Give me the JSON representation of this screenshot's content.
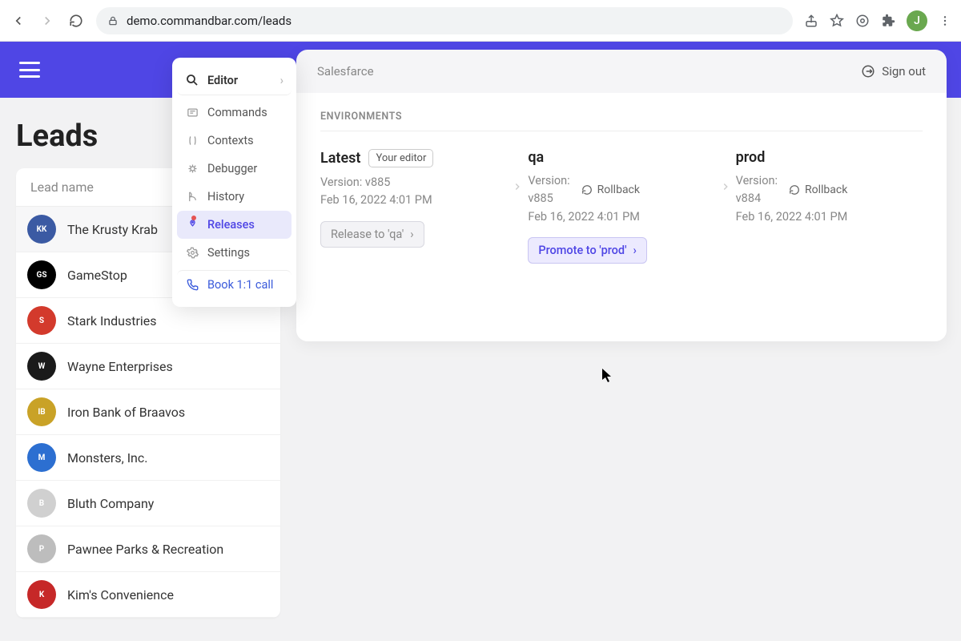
{
  "browser": {
    "url": "demo.commandbar.com/leads",
    "avatar_initial": "J"
  },
  "app": {
    "page_title": "Leads",
    "lead_name_header": "Lead name"
  },
  "leads": [
    {
      "name": "The Krusty Krab",
      "logo_bg": "#3b5aa3",
      "logo_text": "KK"
    },
    {
      "name": "GameStop",
      "logo_bg": "#000000",
      "logo_text": "GS"
    },
    {
      "name": "Stark Industries",
      "logo_bg": "#d33a2c",
      "logo_text": "S"
    },
    {
      "name": "Wayne Enterprises",
      "logo_bg": "#1a1a1a",
      "logo_text": "W"
    },
    {
      "name": "Iron Bank of Braavos",
      "logo_bg": "#c9a227",
      "logo_text": "IB"
    },
    {
      "name": "Monsters, Inc.",
      "logo_bg": "#2c6fd1",
      "logo_text": "M"
    },
    {
      "name": "Bluth Company",
      "logo_bg": "#d0d0d0",
      "logo_text": "B"
    },
    {
      "name": "Pawnee Parks & Recreation",
      "logo_bg": "#bdbdbd",
      "logo_text": "P"
    },
    {
      "name": "Kim's Convenience",
      "logo_bg": "#c62828",
      "logo_text": "K"
    }
  ],
  "editor_menu": {
    "header": "Editor",
    "items": [
      {
        "label": "Commands"
      },
      {
        "label": "Contexts"
      },
      {
        "label": "Debugger"
      },
      {
        "label": "History"
      },
      {
        "label": "Releases",
        "active": true,
        "badge": true
      },
      {
        "label": "Settings"
      }
    ],
    "book_call": "Book 1:1 call"
  },
  "panel": {
    "brand": "Salesfarce",
    "sign_out": "Sign out",
    "section": "ENVIRONMENTS",
    "environments": {
      "latest": {
        "title": "Latest",
        "badge": "Your editor",
        "version_label": "Version: v885",
        "timestamp": "Feb 16, 2022 4:01 PM",
        "action": "Release to 'qa'"
      },
      "qa": {
        "title": "qa",
        "version_label": "Version:",
        "version_value": "v885",
        "timestamp": "Feb 16, 2022 4:01 PM",
        "rollback": "Rollback",
        "action": "Promote to 'prod'"
      },
      "prod": {
        "title": "prod",
        "version_label": "Version:",
        "version_value": "v884",
        "timestamp": "Feb 16, 2022 4:01 PM",
        "rollback": "Rollback"
      }
    }
  }
}
